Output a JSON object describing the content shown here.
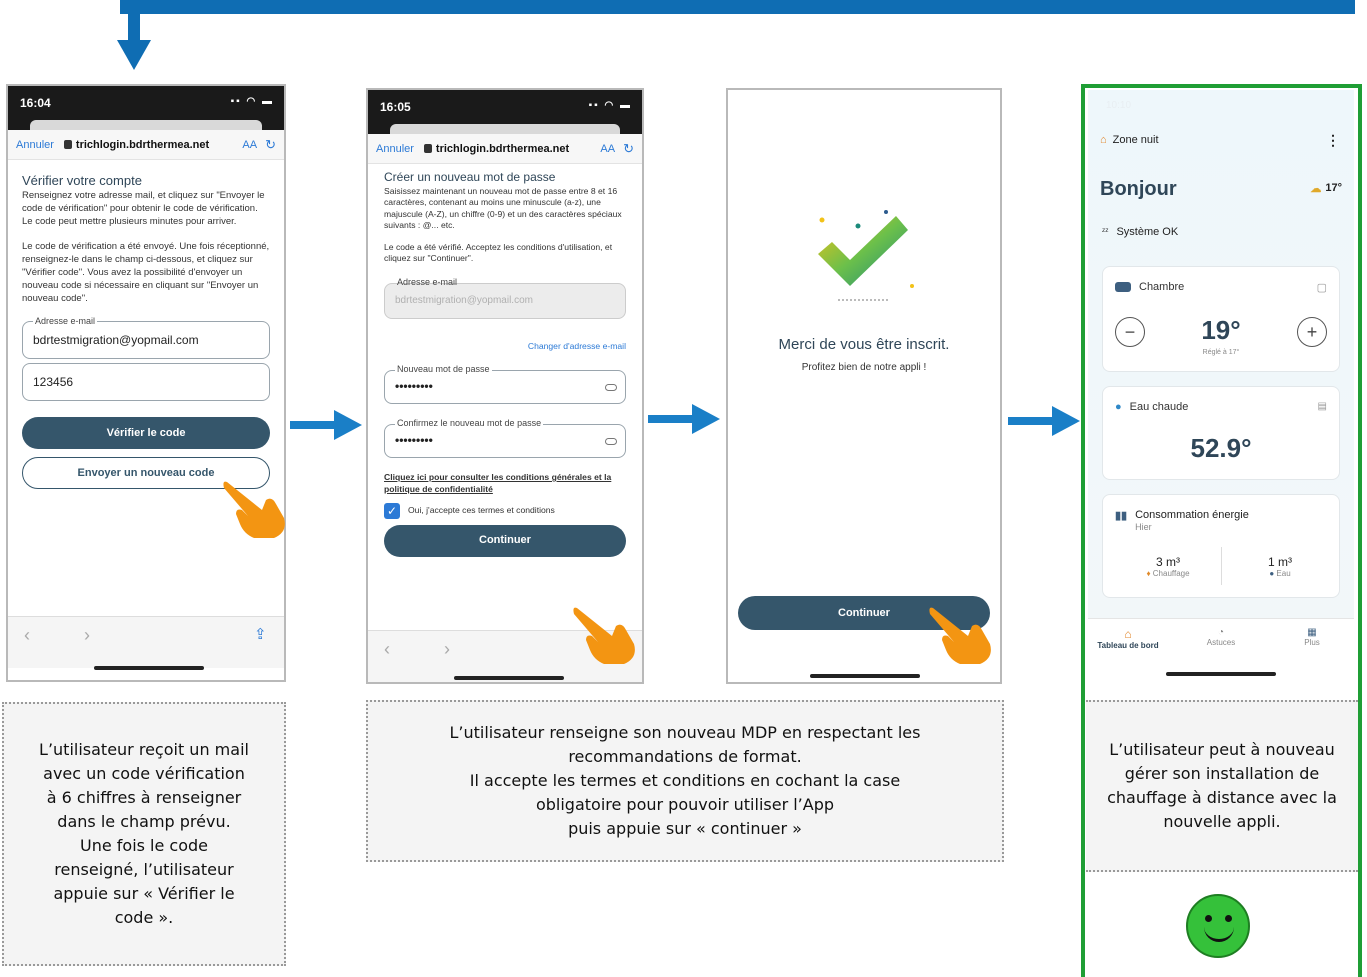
{
  "screen1": {
    "time": "16:04",
    "cancel": "Annuler",
    "url": "trichlogin.bdrthermea.net",
    "aa": "AA",
    "title": "Vérifier votre compte",
    "intro": "Renseignez votre adresse mail, et cliquez sur \"Envoyer le code de vérification\" pour obtenir le code de vérification.",
    "intro2": "Le code peut mettre plusieurs minutes pour arriver.",
    "sent": "Le code de vérification a été envoyé. Une fois réceptionné, renseignez-le dans le champ ci-dessous, et cliquez sur \"Vérifier code\". Vous avez la possibilité d'envoyer un nouveau code si nécessaire en cliquant sur \"Envoyer un nouveau code\".",
    "email_label": "Adresse e-mail",
    "email_value": "bdrtestmigration@yopmail.com",
    "code_value": "123456",
    "verify_button": "Vérifier le code",
    "resend_button": "Envoyer un nouveau code"
  },
  "screen2": {
    "time": "16:05",
    "cancel": "Annuler",
    "url": "trichlogin.bdrthermea.net",
    "aa": "AA",
    "title": "Créer un nouveau mot de passe",
    "intro": "Saisissez maintenant un nouveau mot de passe entre 8 et 16 caractères, contenant au moins une minuscule (a-z), une majuscule (A-Z), un chiffre (0-9) et un des caractères spéciaux suivants : @... etc.",
    "verified": "Le code a été vérifié. Acceptez les conditions d'utilisation, et cliquez sur \"Continuer\".",
    "email_label": "Adresse e-mail",
    "email_value": "bdrtestmigration@yopmail.com",
    "change_email": "Changer d'adresse e-mail",
    "new_pw_label": "Nouveau mot de passe",
    "new_pw_value": "•••••••••",
    "confirm_pw_label": "Confirmez le nouveau mot de passe",
    "confirm_pw_value": "•••••••••",
    "terms_link": "Cliquez ici pour consulter les conditions générales et la politique de confidentialité",
    "accept_label": "Oui, j'accepte ces termes et conditions",
    "continue_button": "Continuer"
  },
  "screen3": {
    "thanks": "Merci de vous être inscrit.",
    "enjoy": "Profitez bien de notre appli !",
    "continue_button": "Continuer"
  },
  "screen4": {
    "time": "10:10",
    "zone": "Zone nuit",
    "greeting": "Bonjour",
    "weather_temp": "17°",
    "system_status": "Système OK",
    "room_name": "Chambre",
    "room_temp": "19°",
    "room_setpoint": "Réglé à 17°",
    "hot_water": "Eau chaude",
    "hot_water_temp": "52.9°",
    "energy_title": "Consommation énergie",
    "energy_period": "Hier",
    "heating_value": "3 m³",
    "heating_label": "Chauffage",
    "water_value": "1 m³",
    "water_label": "Eau",
    "tabs": [
      "Tableau de bord",
      "Astuces",
      "Plus"
    ]
  },
  "captions": {
    "left": "L’utilisateur reçoit un mail avec un code vérification à 6 chiffres à renseigner dans le champ prévu. Une fois le code renseigné, l’utilisateur appuie sur « Vérifier le code ».",
    "middle_lines": [
      "L’utilisateur renseigne son nouveau MDP en respectant les",
      "recommandations de format.",
      "Il accepte les termes et conditions en cochant la case",
      "obligatoire pour pouvoir utiliser l’App",
      "puis appuie sur « continuer »"
    ],
    "right": "L’utilisateur peut à nouveau gérer son installation de chauffage à distance avec la nouvelle appli."
  },
  "colors": {
    "flow_arrow": "#1a7fc7",
    "primary_button": "#35566b",
    "success_border": "#1f9e35",
    "smiley": "#35c13a"
  }
}
